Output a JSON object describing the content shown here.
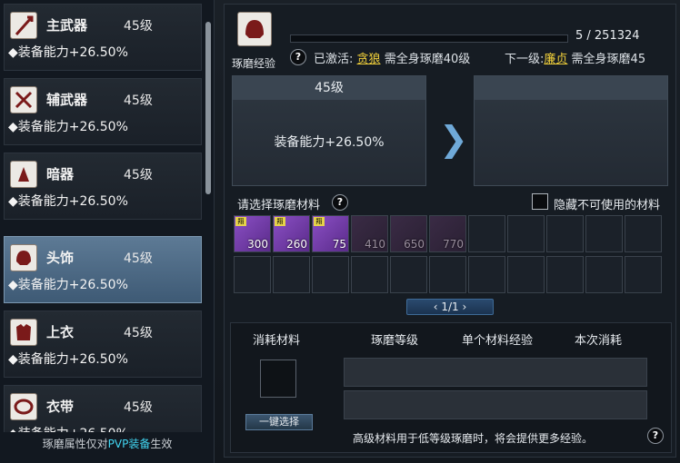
{
  "items": [
    {
      "name": "主武器",
      "level": "45级",
      "bonus": "◆装备能力+26.50%",
      "icon": "spear-icon"
    },
    {
      "name": "辅武器",
      "level": "45级",
      "bonus": "◆装备能力+26.50%",
      "icon": "sword-icon"
    },
    {
      "name": "暗器",
      "level": "45级",
      "bonus": "◆装备能力+26.50%",
      "icon": "dart-icon"
    },
    {
      "name": "头饰",
      "level": "45级",
      "bonus": "◆装备能力+26.50%",
      "icon": "helmet-icon"
    },
    {
      "name": "上衣",
      "level": "45级",
      "bonus": "◆装备能力+26.50%",
      "icon": "armor-icon"
    },
    {
      "name": "衣带",
      "level": "45级",
      "bonus": "◆装备能力+26.50%",
      "icon": "belt-icon"
    }
  ],
  "footer": {
    "pre": "琢磨属性仅对",
    "highlight": "PVP装备",
    "post": "生效"
  },
  "exp": {
    "label": "琢磨经验",
    "progress": "5 / 251324",
    "progress_fraction": 2e-05
  },
  "active": {
    "prefix": "已激活:",
    "star": "贪狼",
    "text": "需全身琢磨40级"
  },
  "next": {
    "prefix": "下一级:",
    "star": "廉贞",
    "text": "需全身琢磨45"
  },
  "current": {
    "level": "45级",
    "bonus": "装备能力+26.50%"
  },
  "select": {
    "title": "请选择琢磨材料",
    "hide_label": "隐藏不可使用的材料"
  },
  "materials": [
    {
      "qty": "300",
      "usable": true,
      "tag": "翔"
    },
    {
      "qty": "260",
      "usable": true,
      "tag": "翔"
    },
    {
      "qty": "75",
      "usable": true,
      "tag": "翔"
    },
    {
      "qty": "410",
      "usable": false,
      "tag": ""
    },
    {
      "qty": "650",
      "usable": false,
      "tag": ""
    },
    {
      "qty": "770",
      "usable": false,
      "tag": ""
    }
  ],
  "pager": {
    "text": "1/1",
    "prev": "‹",
    "next": "›"
  },
  "table": {
    "col1": "消耗材料",
    "col2": "琢磨等级",
    "col3": "单个材料经验",
    "col4": "本次消耗"
  },
  "one_click": "一键选择",
  "note": "高级材料用于低等级琢磨时，将会提供更多经验。",
  "colors": {
    "accent": "#42d6f2",
    "gold": "#f0cf3a",
    "selected": "#4a6885"
  }
}
